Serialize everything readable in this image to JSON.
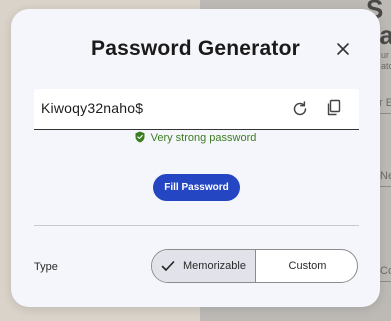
{
  "background": {
    "heading_fragments": [
      "S",
      "Pa"
    ],
    "text_fragments": [
      "ur",
      "ato",
      "r En",
      "Ne",
      "Co"
    ]
  },
  "modal": {
    "title": "Password Generator",
    "password": {
      "value": "Kiwoqy32naho$",
      "strength_text": "Very strong password",
      "strength_color": "#3d7d22"
    },
    "fill_button_label": "Fill Password",
    "type_label": "Type",
    "type_options": [
      {
        "label": "Memorizable",
        "selected": true
      },
      {
        "label": "Custom",
        "selected": false
      }
    ],
    "accent_color": "#2446c2",
    "icons": [
      "close-icon",
      "refresh-icon",
      "copy-icon",
      "shield-check-icon",
      "checkmark-icon"
    ]
  }
}
